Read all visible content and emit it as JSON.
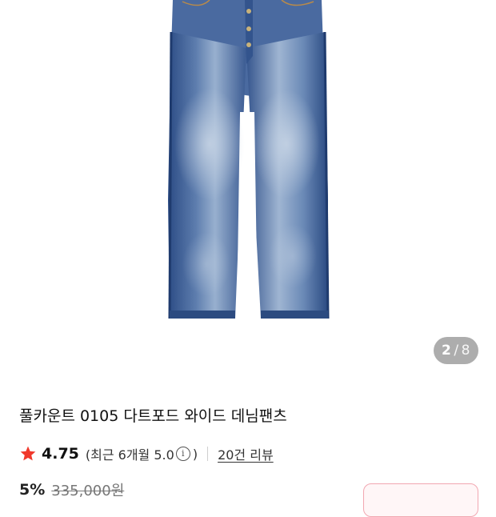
{
  "gallery": {
    "current_index": "2",
    "separator": "/",
    "total": "8",
    "image_subject": "jeans-photo"
  },
  "product": {
    "title": "풀카운트 0105 다트포드 와이드 데님팬츠",
    "rating": {
      "score": "4.75",
      "recent_prefix": "(최근 6개월 5.0",
      "recent_suffix": ")",
      "review_count_label": "20건 리뷰",
      "star_color": "#f0382b"
    },
    "price": {
      "discount": "5%",
      "original": "335,000원"
    }
  },
  "colors": {
    "denim_dark": "#2f4f86",
    "denim_mid": "#5f7fae",
    "denim_light": "#a9bdd6",
    "cta_border": "#f2a7b1"
  }
}
